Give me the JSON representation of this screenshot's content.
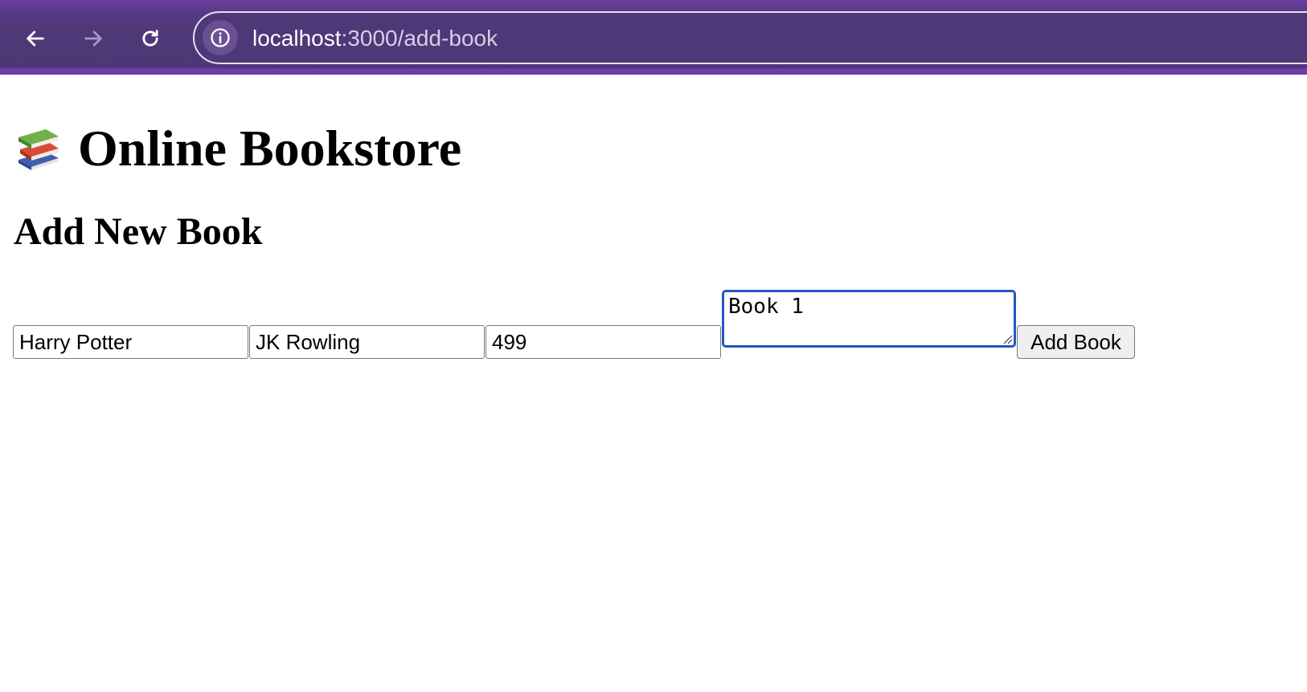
{
  "browser": {
    "url_host": "localhost",
    "url_path": ":3000/add-book",
    "back_icon": "arrow-left-icon",
    "forward_icon": "arrow-right-icon",
    "reload_icon": "reload-icon",
    "info_icon": "info-icon",
    "theme_color": "#4f3878"
  },
  "header": {
    "title": "Online Bookstore",
    "icon": "books-icon"
  },
  "form": {
    "heading": "Add New Book",
    "title_value": "Harry Potter",
    "author_value": "JK Rowling",
    "price_value": "499",
    "description_value": "Book 1",
    "submit_label": "Add Book",
    "focus_color": "#2456c6"
  }
}
